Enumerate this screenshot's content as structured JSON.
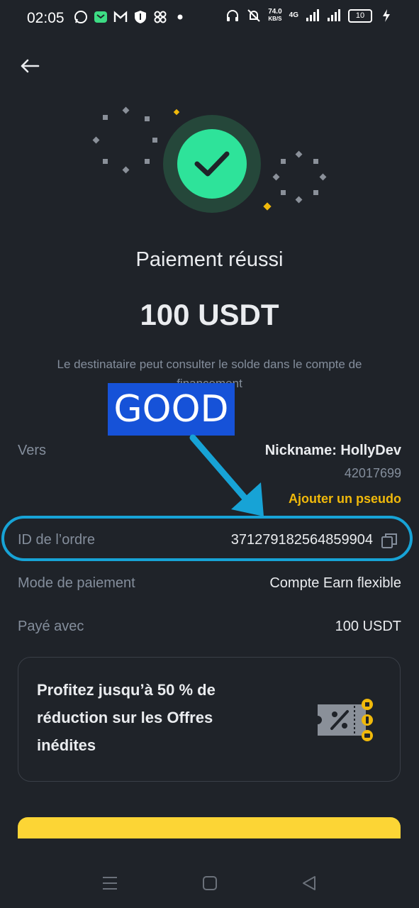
{
  "status_bar": {
    "time": "02:05",
    "speed_value": "74.0",
    "speed_unit": "KB/S",
    "network": "4G",
    "battery": "10",
    "icons": [
      "whatsapp-icon",
      "message-icon",
      "gmail-icon",
      "shield-icon",
      "pinwheel-icon",
      "dot-icon",
      "headphones-icon",
      "bell-off-icon",
      "signal-icon",
      "signal-icon",
      "battery-icon",
      "charging-icon"
    ]
  },
  "header": {
    "back_icon": "arrow-left-icon"
  },
  "result": {
    "title": "Paiement réussi",
    "amount": "100 USDT",
    "description": "Le destinataire peut consulter le solde dans le compte de financement",
    "success_color": "#2ee39a"
  },
  "annotation": {
    "label": "GOOD",
    "label_color": "#1652d8",
    "arrow_color": "#17a3d6"
  },
  "details": {
    "to_label": "Vers",
    "nickname": "Nickname: HollyDev",
    "uid": "42017699",
    "add_alias": "Ajouter un pseudo",
    "order_label": "ID de l’ordre",
    "order_id": "371279182564859904",
    "method_label": "Mode de paiement",
    "method_value": "Compte Earn flexible",
    "paid_label": "Payé avec",
    "paid_value": "100 USDT"
  },
  "promo": {
    "text": "Profitez jusqu’à 50 % de réduction sur les Offres inédites"
  },
  "colors": {
    "background": "#1f2329",
    "accent": "#fcd535",
    "link": "#f0b90b"
  },
  "nav": {
    "icons": [
      "menu-icon",
      "home-square-icon",
      "back-triangle-icon"
    ]
  }
}
